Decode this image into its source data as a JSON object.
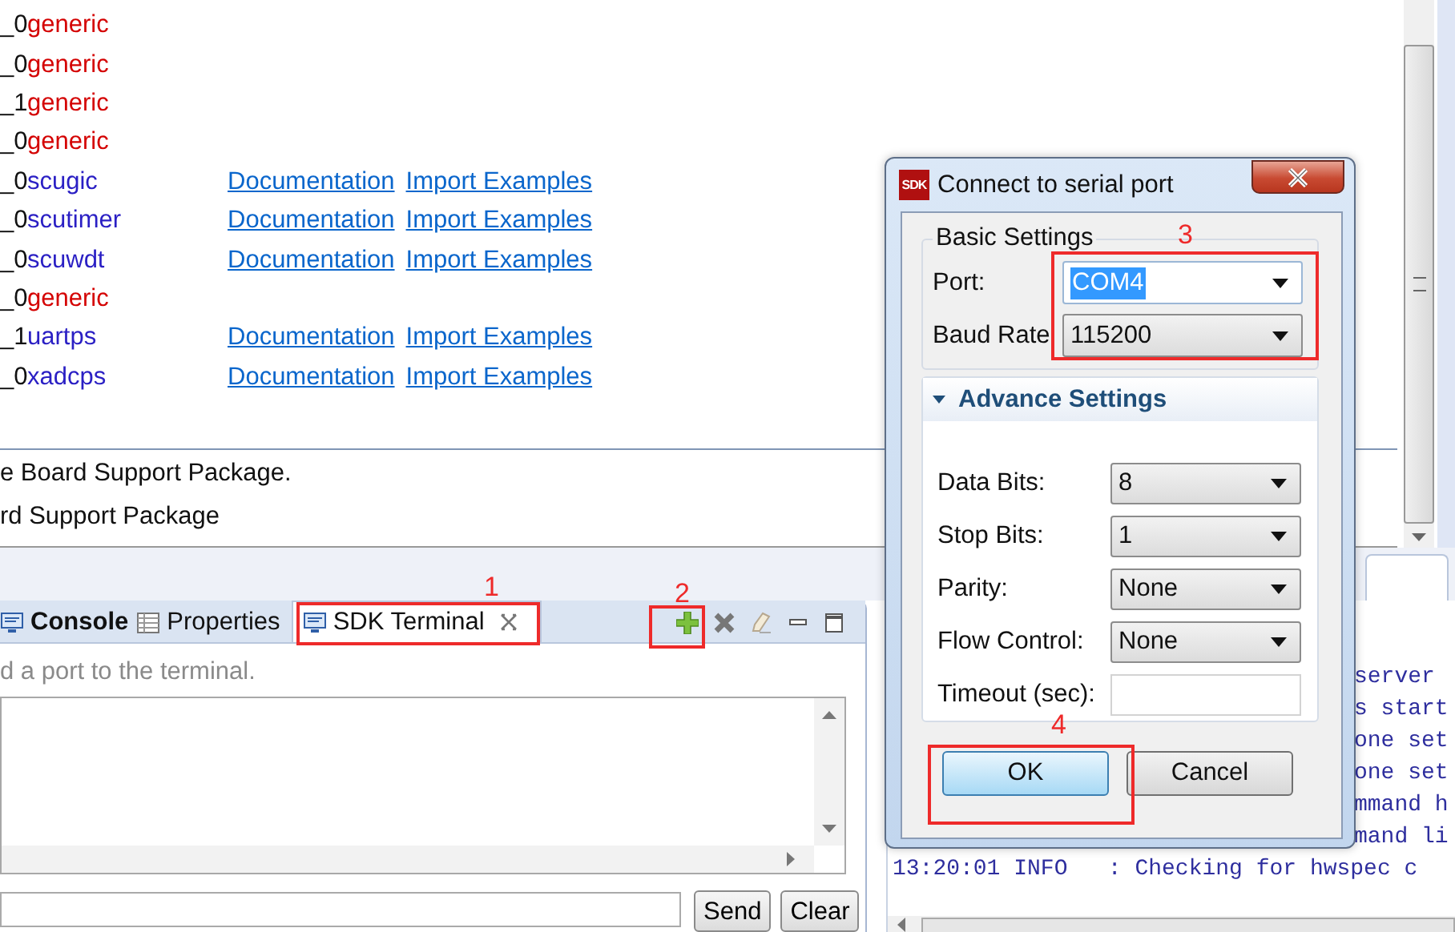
{
  "bsp_list": {
    "rows": [
      {
        "version": "_0",
        "name": "generic",
        "kind": "generic",
        "links": []
      },
      {
        "version": "_0",
        "name": "generic",
        "kind": "generic",
        "links": []
      },
      {
        "version": "_1",
        "name": "generic",
        "kind": "generic",
        "links": []
      },
      {
        "version": "_0",
        "name": "generic",
        "kind": "generic",
        "links": []
      },
      {
        "version": "_0",
        "name": "scugic",
        "kind": "driver",
        "links": [
          "Documentation",
          "Import Examples"
        ]
      },
      {
        "version": "_0",
        "name": "scutimer",
        "kind": "driver",
        "links": [
          "Documentation",
          "Import Examples"
        ]
      },
      {
        "version": "_0",
        "name": "scuwdt",
        "kind": "driver",
        "links": [
          "Documentation",
          "Import Examples"
        ]
      },
      {
        "version": "_0",
        "name": "generic",
        "kind": "generic",
        "links": []
      },
      {
        "version": "_1",
        "name": "uartps",
        "kind": "driver",
        "links": [
          "Documentation",
          "Import Examples"
        ]
      },
      {
        "version": "_0",
        "name": "xadcps",
        "kind": "driver",
        "links": [
          "Documentation",
          "Import Examples"
        ]
      }
    ],
    "description_lines": [
      "e Board Support Package.",
      "rd Support Package"
    ]
  },
  "terminal": {
    "tabs": [
      {
        "label": "Console",
        "kind": "console",
        "selected": false
      },
      {
        "label": "Properties",
        "kind": "properties",
        "selected": false
      },
      {
        "label": "SDK Terminal",
        "kind": "terminal",
        "selected": true
      }
    ],
    "hint": "d a port to the terminal.",
    "buttons": [
      "Send",
      "Clear"
    ]
  },
  "console": {
    "lines": [
      {
        "text": "server",
        "clipped": true
      },
      {
        "text": "s start",
        "clipped": true
      },
      {
        "text": "one set",
        "clipped": true
      },
      {
        "text": "one set",
        "clipped": true
      },
      {
        "text": "mmand h",
        "clipped": true
      },
      {
        "text": "mand li",
        "clipped": true
      },
      {
        "text": "13:20:01 INFO   : Checking for hwspec c",
        "clipped": false
      }
    ]
  },
  "dialog": {
    "title": "Connect to serial port",
    "logo_text": "SDK",
    "basic": {
      "title": "Basic Settings",
      "fields": [
        {
          "label": "Port:",
          "value": "COM4",
          "kind": "editable",
          "highlighted": true
        },
        {
          "label": "Baud Rate",
          "value": "115200",
          "kind": "readonly",
          "highlighted": false
        }
      ]
    },
    "advanced": {
      "title": "Advance Settings",
      "expanded": true,
      "fields": [
        {
          "label": "Data Bits:",
          "value": "8",
          "kind": "combo"
        },
        {
          "label": "Stop Bits:",
          "value": "1",
          "kind": "combo"
        },
        {
          "label": "Parity:",
          "value": "None",
          "kind": "combo"
        },
        {
          "label": "Flow Control:",
          "value": "None",
          "kind": "combo"
        },
        {
          "label": "Timeout (sec):",
          "kind": "text"
        }
      ]
    },
    "buttons": [
      {
        "label": "OK",
        "default": true
      },
      {
        "label": "Cancel",
        "default": false
      }
    ]
  },
  "annotations": [
    {
      "number": "1"
    },
    {
      "number": "2"
    },
    {
      "number": "3"
    },
    {
      "number": "4"
    }
  ]
}
